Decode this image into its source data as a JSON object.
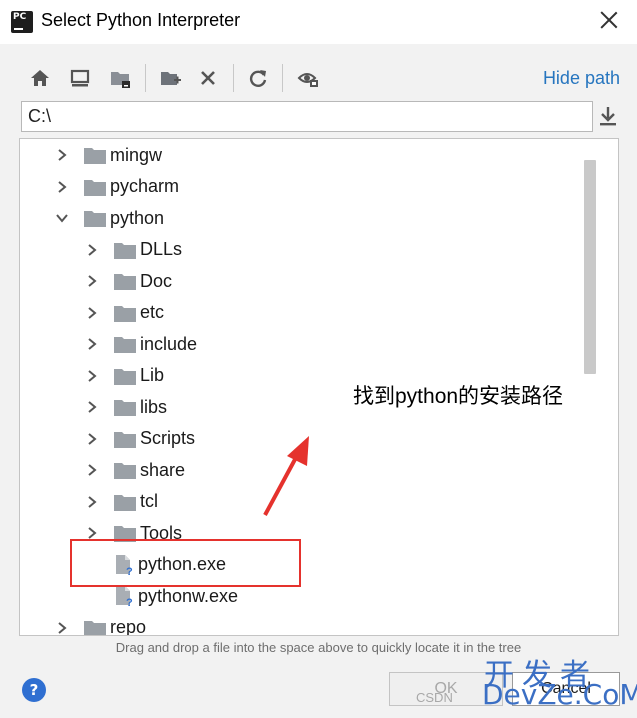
{
  "window": {
    "title": "Select Python Interpreter",
    "app_icon_text": "PC"
  },
  "toolbar": {
    "buttons": [
      {
        "name": "home-icon"
      },
      {
        "name": "desktop-icon"
      },
      {
        "name": "project-folder-icon"
      },
      {
        "name": "new-folder-icon"
      },
      {
        "name": "delete-icon"
      },
      {
        "name": "refresh-icon"
      },
      {
        "name": "show-hidden-icon"
      }
    ],
    "hide_path_label": "Hide path"
  },
  "path_field": {
    "value": "C:\\"
  },
  "tree": {
    "rows": [
      {
        "label": "mingw",
        "level": 0,
        "type": "folder",
        "expanded": false
      },
      {
        "label": "pycharm",
        "level": 0,
        "type": "folder",
        "expanded": false
      },
      {
        "label": "python",
        "level": 0,
        "type": "folder",
        "expanded": true
      },
      {
        "label": "DLLs",
        "level": 1,
        "type": "folder",
        "expanded": false
      },
      {
        "label": "Doc",
        "level": 1,
        "type": "folder",
        "expanded": false
      },
      {
        "label": "etc",
        "level": 1,
        "type": "folder",
        "expanded": false
      },
      {
        "label": "include",
        "level": 1,
        "type": "folder",
        "expanded": false
      },
      {
        "label": "Lib",
        "level": 1,
        "type": "folder",
        "expanded": false
      },
      {
        "label": "libs",
        "level": 1,
        "type": "folder",
        "expanded": false
      },
      {
        "label": "Scripts",
        "level": 1,
        "type": "folder",
        "expanded": false
      },
      {
        "label": "share",
        "level": 1,
        "type": "folder",
        "expanded": false
      },
      {
        "label": "tcl",
        "level": 1,
        "type": "folder",
        "expanded": false
      },
      {
        "label": "Tools",
        "level": 1,
        "type": "folder",
        "expanded": false
      },
      {
        "label": "python.exe",
        "level": 1,
        "type": "file"
      },
      {
        "label": "pythonw.exe",
        "level": 1,
        "type": "file"
      },
      {
        "label": "repo",
        "level": 0,
        "type": "folder",
        "expanded": false
      }
    ]
  },
  "annotation": {
    "text": "找到python的安装路径",
    "color": "#e5322d"
  },
  "hint": "Drag and drop a file into the space above to quickly locate it in the tree",
  "buttons": {
    "ok": "OK",
    "cancel": "Cancel",
    "help": "?"
  },
  "watermark": {
    "line1": "开发者",
    "line2": "DevZe.CoM",
    "line3": "CSDN"
  },
  "colors": {
    "accent_link": "#2675bf",
    "annotation_red": "#e5322d",
    "folder_gray": "#9aa0a6"
  }
}
